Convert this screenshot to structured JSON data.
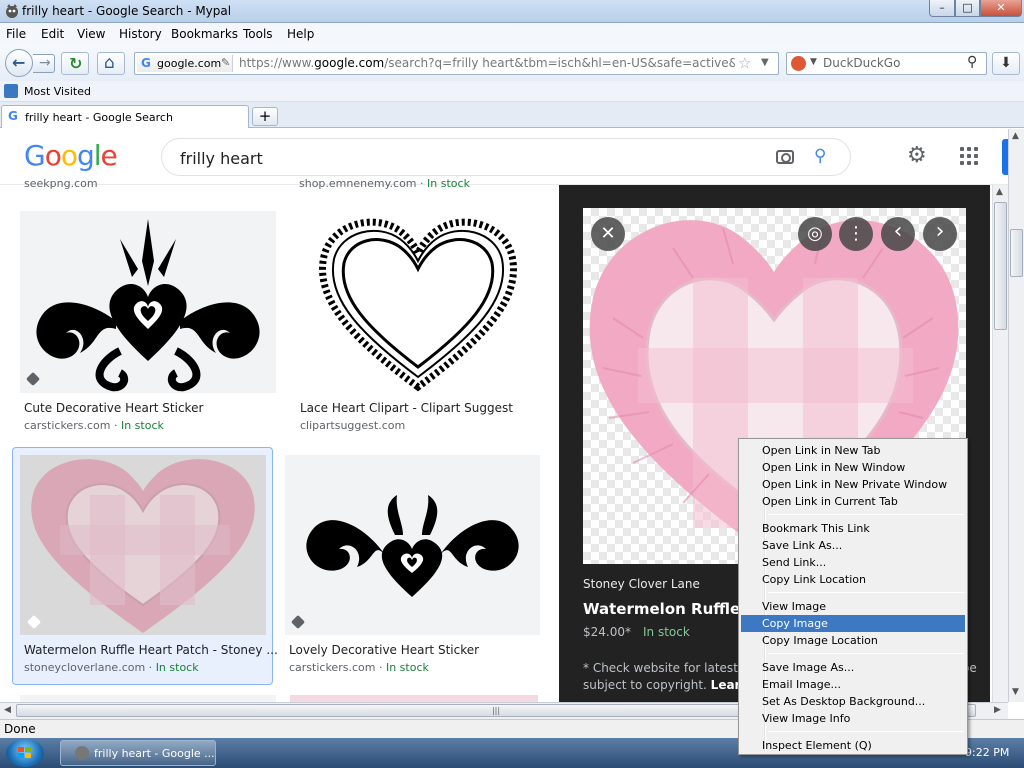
{
  "window": {
    "title": "frilly heart - Google Search - Mypal",
    "min_glyph": "–",
    "max_glyph": "□",
    "close_glyph": "✕"
  },
  "menu": {
    "file": "File",
    "edit": "Edit",
    "view": "View",
    "history": "History",
    "bookmarks": "Bookmarks",
    "tools": "Tools",
    "help": "Help"
  },
  "nav": {
    "back_glyph": "←",
    "fwd_glyph": "→",
    "reload_glyph": "↻",
    "home_glyph": "⌂",
    "identity_favicon": "G",
    "identity_domain": "google.com",
    "url_prefix": "https://www.",
    "url_domain": "google.com",
    "url_rest": "/search?q=frilly heart&tbm=isch&hl=en-US&safe=active&tbs=ic:trans",
    "star_glyph": "☆",
    "dropdown_glyph": "▼",
    "search_placeholder": "DuckDuckGo",
    "search_drop_glyph": "▼",
    "search_mag_glyph": "⚲",
    "download_glyph": "⬇"
  },
  "bookmarks": {
    "most_visited": "Most Visited"
  },
  "tabs": {
    "active_favicon": "G",
    "active_label": "frilly heart - Google Search",
    "new_tab_glyph": "+"
  },
  "google": {
    "logo": [
      "G",
      "o",
      "o",
      "g",
      "l",
      "e"
    ],
    "query": "frilly heart",
    "search_icon_glyph": "⚲",
    "gear_glyph": "⚙"
  },
  "results": {
    "cut_top": [
      {
        "source": "seekpng.com",
        "stock": ""
      },
      {
        "source": "shop.emnenemy.com",
        "stock": "In stock"
      }
    ],
    "cards": [
      {
        "caption": "Cute Decorative Heart Sticker",
        "source": "carstickers.com",
        "stock": "In stock",
        "sep": " · "
      },
      {
        "caption": "Lace Heart Clipart - Clipart Suggest",
        "source": "clipartsuggest.com",
        "stock": "",
        "sep": ""
      },
      {
        "caption": "Watermelon Ruffle Heart Patch - Stoney ...",
        "source": "stoneycloverlane.com",
        "stock": "In stock",
        "sep": " · "
      },
      {
        "caption": "Lovely Decorative Heart Sticker",
        "source": "carstickers.com",
        "stock": "In stock",
        "sep": " · "
      }
    ]
  },
  "preview": {
    "source": "Stoney Clover Lane",
    "title": "Watermelon Ruffle Heart Patch",
    "price": "$24.00*",
    "stock": "In stock",
    "note_line1": "* Check website for latest pricing and availability. Images may be",
    "note_line2_a": "subject to copyright.",
    "note_learn_more": "Learn More",
    "close_glyph": "✕",
    "lens_glyph": "◎",
    "more_glyph": "⋮",
    "prev_glyph": "‹",
    "next_glyph": "›"
  },
  "context_menu": {
    "items": [
      "Open Link in New Tab",
      "Open Link in New Window",
      "Open Link in New Private Window",
      "Open Link in Current Tab",
      "Bookmark This Link",
      "Save Link As...",
      "Send Link...",
      "Copy Link Location",
      "View Image",
      "Copy Image",
      "Copy Image Location",
      "Save Image As...",
      "Email Image...",
      "Set As Desktop Background...",
      "View Image Info",
      "Inspect Element (Q)"
    ],
    "highlighted": "Copy Image"
  },
  "scrollbar": {
    "up_glyph": "▲",
    "down_glyph": "▼",
    "left_glyph": "◀",
    "right_glyph": "▶",
    "grip_glyph": "|||",
    "vgrip_glyph": "≡"
  },
  "status": {
    "text": "Done"
  },
  "taskbar": {
    "item_label": "frilly heart - Google ...",
    "clock": "9:22 PM"
  },
  "colors": {
    "selection_blue": "#3d79c3",
    "preview_bg": "#222222",
    "google_blue": "#4285f4",
    "in_stock_green": "#188038"
  }
}
